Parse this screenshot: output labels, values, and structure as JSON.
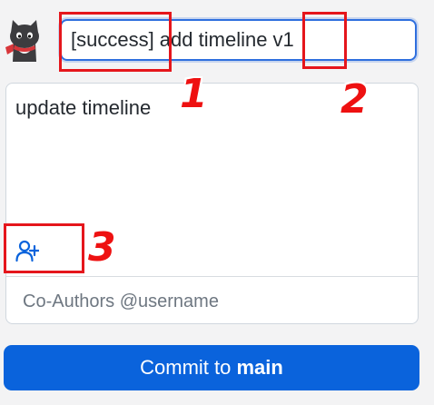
{
  "avatar": {
    "icon": "cat-avatar-icon"
  },
  "commit_form": {
    "summary_value": "[success] add timeline v1",
    "description_value": "update timeline",
    "coauthors_placeholder": "Co-Authors @username",
    "add_coauthor_icon": "person-add-icon",
    "commit_button": {
      "prefix": "Commit to",
      "branch": "main"
    }
  },
  "annotations": [
    {
      "label": "1"
    },
    {
      "label": "2"
    },
    {
      "label": "3"
    }
  ],
  "colors": {
    "accent": "#0a63dc",
    "focus_border": "#2f6fde",
    "annotation": "#e5161c",
    "background": "#f3f3f4"
  }
}
